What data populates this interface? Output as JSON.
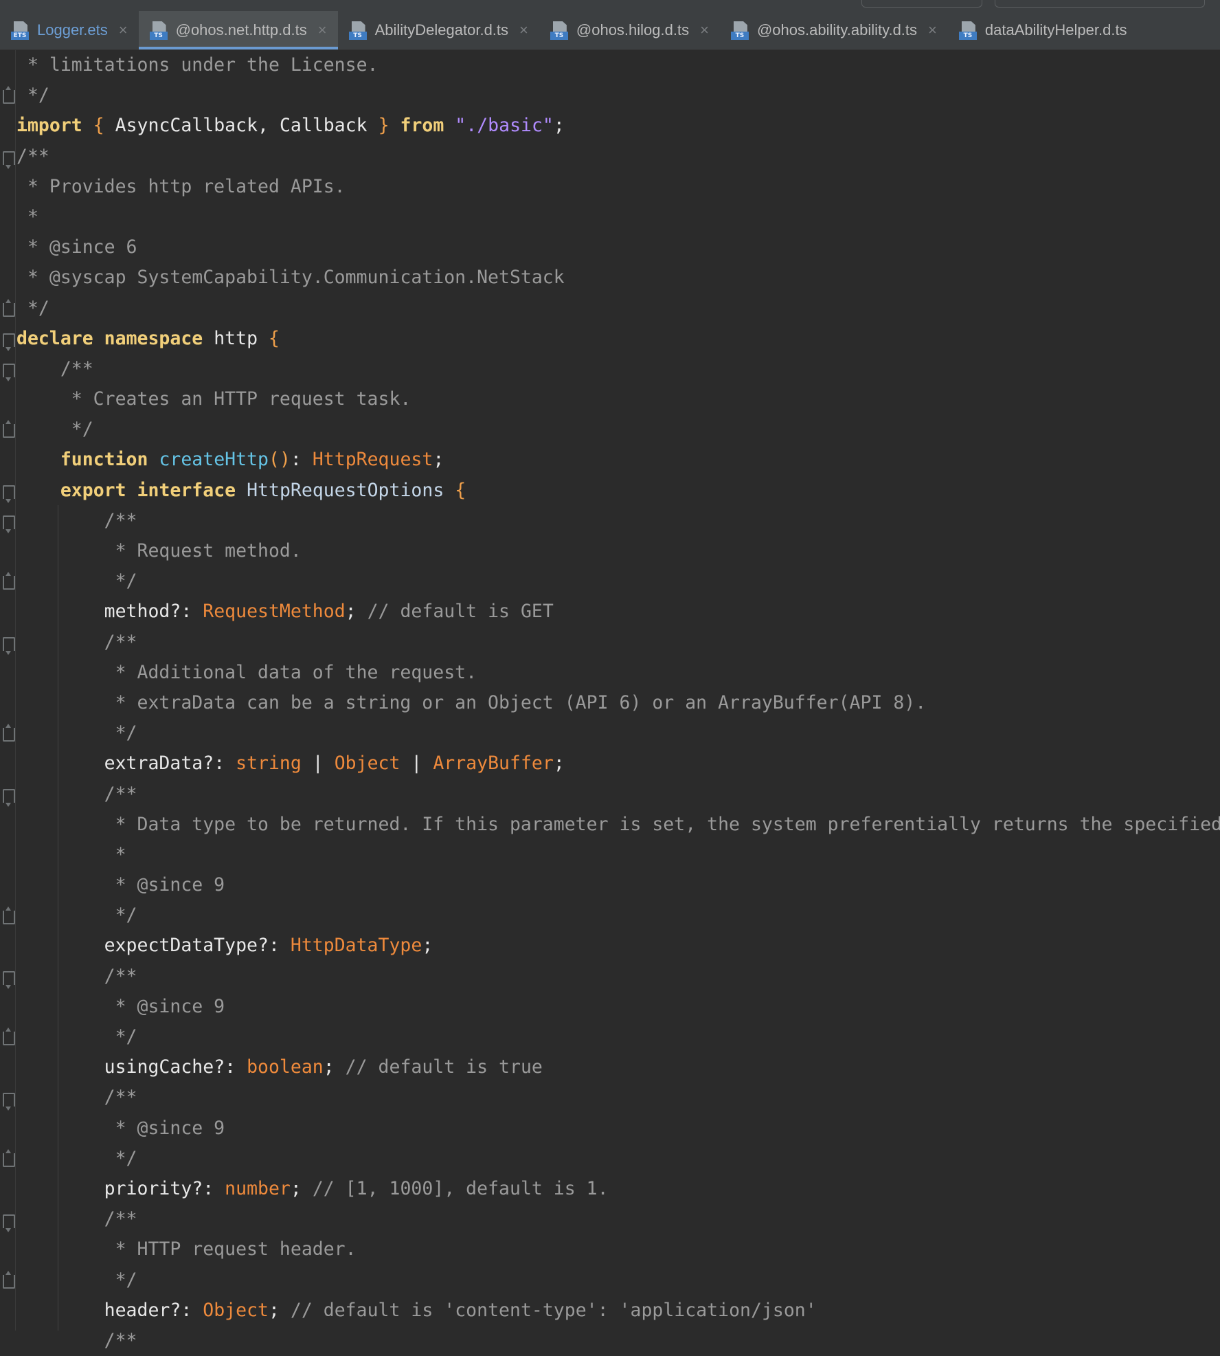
{
  "tabs": [
    {
      "label": "Logger.ets",
      "badge": "ETS",
      "active": false,
      "closable": true
    },
    {
      "label": "@ohos.net.http.d.ts",
      "badge": "TS",
      "active": true,
      "closable": true
    },
    {
      "label": "AbilityDelegator.d.ts",
      "badge": "TS",
      "active": false,
      "closable": true
    },
    {
      "label": "@ohos.hilog.d.ts",
      "badge": "TS",
      "active": false,
      "closable": true
    },
    {
      "label": "@ohos.ability.ability.d.ts",
      "badge": "TS",
      "active": false,
      "closable": true
    },
    {
      "label": "dataAbilityHelper.d.ts",
      "badge": "TS",
      "active": false,
      "closable": false
    }
  ],
  "close_glyph": "×",
  "lines": [
    [
      [
        "cm",
        " * limitations under the License."
      ]
    ],
    [
      [
        "cm",
        " */"
      ]
    ],
    [
      [
        "kw",
        "import"
      ],
      [
        "id",
        " "
      ],
      [
        "brace",
        "{"
      ],
      [
        "id",
        " AsyncCallback"
      ],
      [
        "punct",
        ","
      ],
      [
        "id",
        " Callback "
      ],
      [
        "brace",
        "}"
      ],
      [
        "id",
        " "
      ],
      [
        "kw",
        "from"
      ],
      [
        "id",
        " "
      ],
      [
        "str",
        "\"./basic\""
      ],
      [
        "punct",
        ";"
      ]
    ],
    [
      [
        "cm",
        "/**"
      ]
    ],
    [
      [
        "cm",
        " * Provides http related APIs."
      ]
    ],
    [
      [
        "cm",
        " *"
      ]
    ],
    [
      [
        "cm",
        " * @since 6"
      ]
    ],
    [
      [
        "cm",
        " * @syscap SystemCapability.Communication.NetStack"
      ]
    ],
    [
      [
        "cm",
        " */"
      ]
    ],
    [
      [
        "kw",
        "declare"
      ],
      [
        "id",
        " "
      ],
      [
        "kw",
        "namespace"
      ],
      [
        "id",
        " http "
      ],
      [
        "brace",
        "{"
      ]
    ],
    [
      [
        "cm",
        "    /**"
      ]
    ],
    [
      [
        "cm",
        "     * Creates an HTTP request task."
      ]
    ],
    [
      [
        "cm",
        "     */"
      ]
    ],
    [
      [
        "id",
        "    "
      ],
      [
        "kw",
        "function"
      ],
      [
        "id",
        " "
      ],
      [
        "fn",
        "createHttp"
      ],
      [
        "brace",
        "()"
      ],
      [
        "punct",
        ": "
      ],
      [
        "type",
        "HttpRequest"
      ],
      [
        "punct",
        ";"
      ]
    ],
    [
      [
        "id",
        "    "
      ],
      [
        "kw",
        "export"
      ],
      [
        "id",
        " "
      ],
      [
        "kw",
        "interface"
      ],
      [
        "id",
        " "
      ],
      [
        "iface",
        "HttpRequestOptions"
      ],
      [
        "id",
        " "
      ],
      [
        "brace",
        "{"
      ]
    ],
    [
      [
        "cm",
        "        /**"
      ]
    ],
    [
      [
        "cm",
        "         * Request method."
      ]
    ],
    [
      [
        "cm",
        "         */"
      ]
    ],
    [
      [
        "id",
        "        method"
      ],
      [
        "punct",
        "?: "
      ],
      [
        "type",
        "RequestMethod"
      ],
      [
        "punct",
        "; "
      ],
      [
        "cm",
        "// default is GET"
      ]
    ],
    [
      [
        "cm",
        "        /**"
      ]
    ],
    [
      [
        "cm",
        "         * Additional data of the request."
      ]
    ],
    [
      [
        "cm",
        "         * extraData can be a string or an Object (API 6) or an ArrayBuffer(API 8)."
      ]
    ],
    [
      [
        "cm",
        "         */"
      ]
    ],
    [
      [
        "id",
        "        extraData"
      ],
      [
        "punct",
        "?: "
      ],
      [
        "type",
        "string"
      ],
      [
        "op",
        " | "
      ],
      [
        "type",
        "Object"
      ],
      [
        "op",
        " | "
      ],
      [
        "type",
        "ArrayBuffer"
      ],
      [
        "punct",
        ";"
      ]
    ],
    [
      [
        "cm",
        "        /**"
      ]
    ],
    [
      [
        "cm",
        "         * Data type to be returned. If this parameter is set, the system preferentially returns the specified"
      ]
    ],
    [
      [
        "cm",
        "         *"
      ]
    ],
    [
      [
        "cm",
        "         * @since 9"
      ]
    ],
    [
      [
        "cm",
        "         */"
      ]
    ],
    [
      [
        "id",
        "        expectDataType"
      ],
      [
        "punct",
        "?: "
      ],
      [
        "type",
        "HttpDataType"
      ],
      [
        "punct",
        ";"
      ]
    ],
    [
      [
        "cm",
        "        /**"
      ]
    ],
    [
      [
        "cm",
        "         * @since 9"
      ]
    ],
    [
      [
        "cm",
        "         */"
      ]
    ],
    [
      [
        "id",
        "        usingCache"
      ],
      [
        "punct",
        "?: "
      ],
      [
        "type",
        "boolean"
      ],
      [
        "punct",
        "; "
      ],
      [
        "cm",
        "// default is true"
      ]
    ],
    [
      [
        "cm",
        "        /**"
      ]
    ],
    [
      [
        "cm",
        "         * @since 9"
      ]
    ],
    [
      [
        "cm",
        "         */"
      ]
    ],
    [
      [
        "id",
        "        priority"
      ],
      [
        "punct",
        "?: "
      ],
      [
        "type",
        "number"
      ],
      [
        "punct",
        "; "
      ],
      [
        "cm",
        "// [1, 1000], default is 1."
      ]
    ],
    [
      [
        "cm",
        "        /**"
      ]
    ],
    [
      [
        "cm",
        "         * HTTP request header."
      ]
    ],
    [
      [
        "cm",
        "         */"
      ]
    ],
    [
      [
        "id",
        "        header"
      ],
      [
        "punct",
        "?: "
      ],
      [
        "type",
        "Object"
      ],
      [
        "punct",
        "; "
      ],
      [
        "cm",
        "// default is 'content-type': 'application/json'"
      ]
    ],
    [
      [
        "cm",
        "        /**"
      ]
    ]
  ],
  "folds": [
    {
      "line": 1,
      "kind": "close"
    },
    {
      "line": 3,
      "kind": "open"
    },
    {
      "line": 8,
      "kind": "close"
    },
    {
      "line": 9,
      "kind": "open"
    },
    {
      "line": 10,
      "kind": "open"
    },
    {
      "line": 12,
      "kind": "close"
    },
    {
      "line": 14,
      "kind": "open"
    },
    {
      "line": 15,
      "kind": "open"
    },
    {
      "line": 17,
      "kind": "close"
    },
    {
      "line": 19,
      "kind": "open"
    },
    {
      "line": 22,
      "kind": "close"
    },
    {
      "line": 24,
      "kind": "open"
    },
    {
      "line": 28,
      "kind": "close"
    },
    {
      "line": 30,
      "kind": "open"
    },
    {
      "line": 32,
      "kind": "close"
    },
    {
      "line": 34,
      "kind": "open"
    },
    {
      "line": 36,
      "kind": "close"
    },
    {
      "line": 38,
      "kind": "open"
    },
    {
      "line": 40,
      "kind": "close"
    }
  ]
}
